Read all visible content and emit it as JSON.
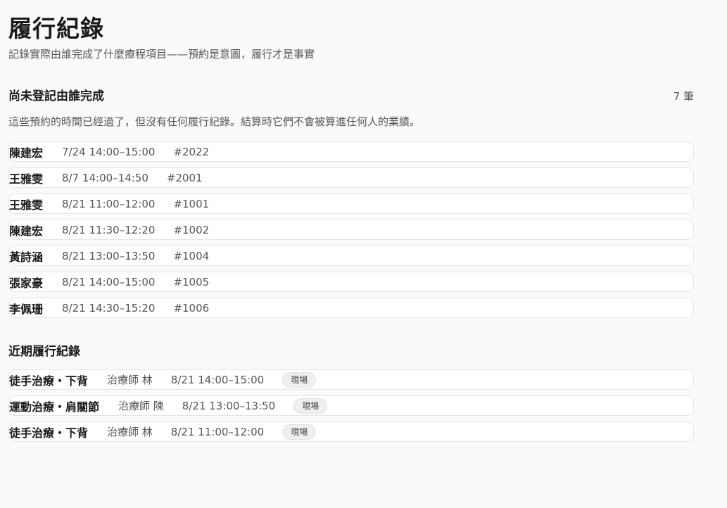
{
  "page": {
    "title": "履行紀錄",
    "subtitle": "記錄實際由誰完成了什麼療程項目——預約是意圖，履行才是事實"
  },
  "pending": {
    "title": "尚未登記由誰完成",
    "count": "7 筆",
    "description": "這些預約的時間已經過了，但沒有任何履行紀錄。結算時它們不會被算進任何人的業績。",
    "items": [
      {
        "name": "陳建宏",
        "time": "7/24 14:00–15:00",
        "ref": "#2022"
      },
      {
        "name": "王雅雯",
        "time": "8/7 14:00–14:50",
        "ref": "#2001"
      },
      {
        "name": "王雅雯",
        "time": "8/21 11:00–12:00",
        "ref": "#1001"
      },
      {
        "name": "陳建宏",
        "time": "8/21 11:30–12:20",
        "ref": "#1002"
      },
      {
        "name": "黃詩涵",
        "time": "8/21 13:00–13:50",
        "ref": "#1004"
      },
      {
        "name": "張家豪",
        "time": "8/21 14:00–15:00",
        "ref": "#1005"
      },
      {
        "name": "李佩珊",
        "time": "8/21 14:30–15:20",
        "ref": "#1006"
      }
    ]
  },
  "recent": {
    "title": "近期履行紀錄",
    "items": [
      {
        "service": "徒手治療・下背",
        "therapist": "治療師 林",
        "time": "8/21 14:00–15:00",
        "badge": "現場"
      },
      {
        "service": "運動治療・肩關節",
        "therapist": "治療師 陳",
        "time": "8/21 13:00–13:50",
        "badge": "現場"
      },
      {
        "service": "徒手治療・下背",
        "therapist": "治療師 林",
        "time": "8/21 11:00–12:00",
        "badge": "現場"
      }
    ]
  }
}
